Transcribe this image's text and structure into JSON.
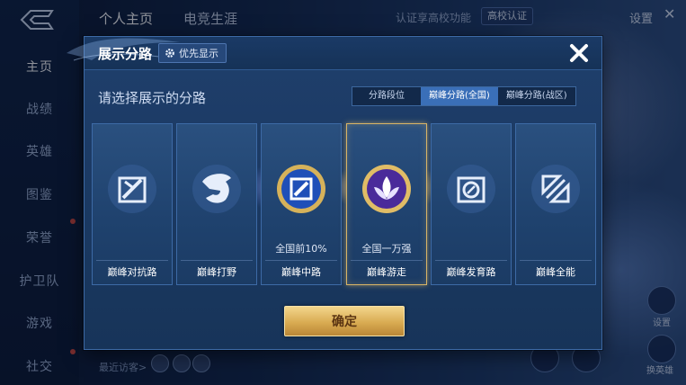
{
  "background": {
    "top_tabs": [
      "个人主页",
      "电竞生涯"
    ],
    "top_note": "认证享高校功能",
    "top_badge": "高校认证",
    "settings_label": "设置",
    "left_nav": [
      "主页",
      "战绩",
      "英雄",
      "图鉴",
      "荣誉",
      "护卫队",
      "游戏",
      "社交"
    ],
    "visitors_label": "最近访客>",
    "right_labels": [
      "设置",
      "换英雄"
    ]
  },
  "dialog": {
    "title": "展示分路",
    "priority_label": "优先显示",
    "prompt": "请选择展示的分路",
    "segments": [
      "分路段位",
      "巅峰分路(全国)",
      "巅峰分路(战区)"
    ],
    "active_segment": "巅峰分路(全国)",
    "cards": [
      {
        "name": "巅峰对抗路",
        "rank": "",
        "icon": "clash-lane-icon",
        "selected": false
      },
      {
        "name": "巅峰打野",
        "rank": "",
        "icon": "jungle-icon",
        "selected": false
      },
      {
        "name": "巅峰中路",
        "rank": "全国前10%",
        "icon": "mid-lane-icon",
        "selected": false
      },
      {
        "name": "巅峰游走",
        "rank": "全国一万强",
        "icon": "roam-icon",
        "selected": true
      },
      {
        "name": "巅峰发育路",
        "rank": "",
        "icon": "farm-lane-icon",
        "selected": false
      },
      {
        "name": "巅峰全能",
        "rank": "",
        "icon": "all-round-icon",
        "selected": false
      }
    ],
    "confirm_label": "确定"
  },
  "colors": {
    "accent_gold": "#d8b466",
    "dialog_bg": "#1f3f6c",
    "active_tab": "#3a6fb8"
  }
}
